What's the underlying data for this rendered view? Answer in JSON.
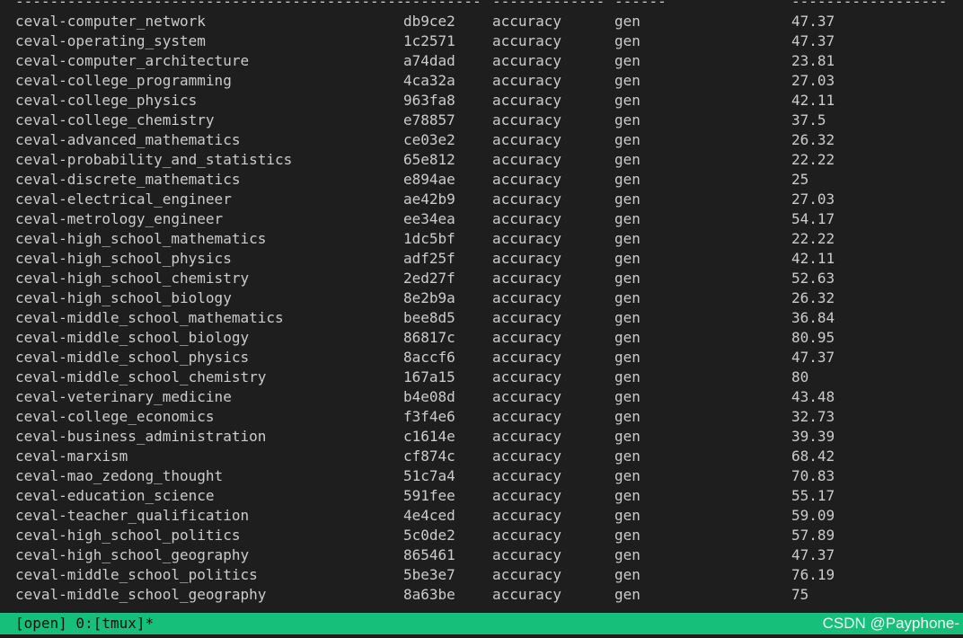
{
  "table": {
    "separator": {
      "dataset": "---------------------------------------------",
      "version": "---------",
      "metric": "-------------",
      "mode": "------",
      "score": "------------------"
    },
    "rows": [
      {
        "dataset": "ceval-computer_network",
        "version": "db9ce2",
        "metric": "accuracy",
        "mode": "gen",
        "score": "47.37"
      },
      {
        "dataset": "ceval-operating_system",
        "version": "1c2571",
        "metric": "accuracy",
        "mode": "gen",
        "score": "47.37"
      },
      {
        "dataset": "ceval-computer_architecture",
        "version": "a74dad",
        "metric": "accuracy",
        "mode": "gen",
        "score": "23.81"
      },
      {
        "dataset": "ceval-college_programming",
        "version": "4ca32a",
        "metric": "accuracy",
        "mode": "gen",
        "score": "27.03"
      },
      {
        "dataset": "ceval-college_physics",
        "version": "963fa8",
        "metric": "accuracy",
        "mode": "gen",
        "score": "42.11"
      },
      {
        "dataset": "ceval-college_chemistry",
        "version": "e78857",
        "metric": "accuracy",
        "mode": "gen",
        "score": "37.5"
      },
      {
        "dataset": "ceval-advanced_mathematics",
        "version": "ce03e2",
        "metric": "accuracy",
        "mode": "gen",
        "score": "26.32"
      },
      {
        "dataset": "ceval-probability_and_statistics",
        "version": "65e812",
        "metric": "accuracy",
        "mode": "gen",
        "score": "22.22"
      },
      {
        "dataset": "ceval-discrete_mathematics",
        "version": "e894ae",
        "metric": "accuracy",
        "mode": "gen",
        "score": "25"
      },
      {
        "dataset": "ceval-electrical_engineer",
        "version": "ae42b9",
        "metric": "accuracy",
        "mode": "gen",
        "score": "27.03"
      },
      {
        "dataset": "ceval-metrology_engineer",
        "version": "ee34ea",
        "metric": "accuracy",
        "mode": "gen",
        "score": "54.17"
      },
      {
        "dataset": "ceval-high_school_mathematics",
        "version": "1dc5bf",
        "metric": "accuracy",
        "mode": "gen",
        "score": "22.22"
      },
      {
        "dataset": "ceval-high_school_physics",
        "version": "adf25f",
        "metric": "accuracy",
        "mode": "gen",
        "score": "42.11"
      },
      {
        "dataset": "ceval-high_school_chemistry",
        "version": "2ed27f",
        "metric": "accuracy",
        "mode": "gen",
        "score": "52.63"
      },
      {
        "dataset": "ceval-high_school_biology",
        "version": "8e2b9a",
        "metric": "accuracy",
        "mode": "gen",
        "score": "26.32"
      },
      {
        "dataset": "ceval-middle_school_mathematics",
        "version": "bee8d5",
        "metric": "accuracy",
        "mode": "gen",
        "score": "36.84"
      },
      {
        "dataset": "ceval-middle_school_biology",
        "version": "86817c",
        "metric": "accuracy",
        "mode": "gen",
        "score": "80.95"
      },
      {
        "dataset": "ceval-middle_school_physics",
        "version": "8accf6",
        "metric": "accuracy",
        "mode": "gen",
        "score": "47.37"
      },
      {
        "dataset": "ceval-middle_school_chemistry",
        "version": "167a15",
        "metric": "accuracy",
        "mode": "gen",
        "score": "80"
      },
      {
        "dataset": "ceval-veterinary_medicine",
        "version": "b4e08d",
        "metric": "accuracy",
        "mode": "gen",
        "score": "43.48"
      },
      {
        "dataset": "ceval-college_economics",
        "version": "f3f4e6",
        "metric": "accuracy",
        "mode": "gen",
        "score": "32.73"
      },
      {
        "dataset": "ceval-business_administration",
        "version": "c1614e",
        "metric": "accuracy",
        "mode": "gen",
        "score": "39.39"
      },
      {
        "dataset": "ceval-marxism",
        "version": "cf874c",
        "metric": "accuracy",
        "mode": "gen",
        "score": "68.42"
      },
      {
        "dataset": "ceval-mao_zedong_thought",
        "version": "51c7a4",
        "metric": "accuracy",
        "mode": "gen",
        "score": "70.83"
      },
      {
        "dataset": "ceval-education_science",
        "version": "591fee",
        "metric": "accuracy",
        "mode": "gen",
        "score": "55.17"
      },
      {
        "dataset": "ceval-teacher_qualification",
        "version": "4e4ced",
        "metric": "accuracy",
        "mode": "gen",
        "score": "59.09"
      },
      {
        "dataset": "ceval-high_school_politics",
        "version": "5c0de2",
        "metric": "accuracy",
        "mode": "gen",
        "score": "57.89"
      },
      {
        "dataset": "ceval-high_school_geography",
        "version": "865461",
        "metric": "accuracy",
        "mode": "gen",
        "score": "47.37"
      },
      {
        "dataset": "ceval-middle_school_politics",
        "version": "5be3e7",
        "metric": "accuracy",
        "mode": "gen",
        "score": "76.19"
      },
      {
        "dataset": "ceval-middle_school_geography",
        "version": "8a63be",
        "metric": "accuracy",
        "mode": "gen",
        "score": "75"
      }
    ]
  },
  "status_bar": {
    "session": "[open] 0:[tmux]*",
    "watermark": "CSDN @Payphone-"
  },
  "colors": {
    "background": "#1e1e1e",
    "text": "#cccccc",
    "status_bar": "#16c07a"
  }
}
